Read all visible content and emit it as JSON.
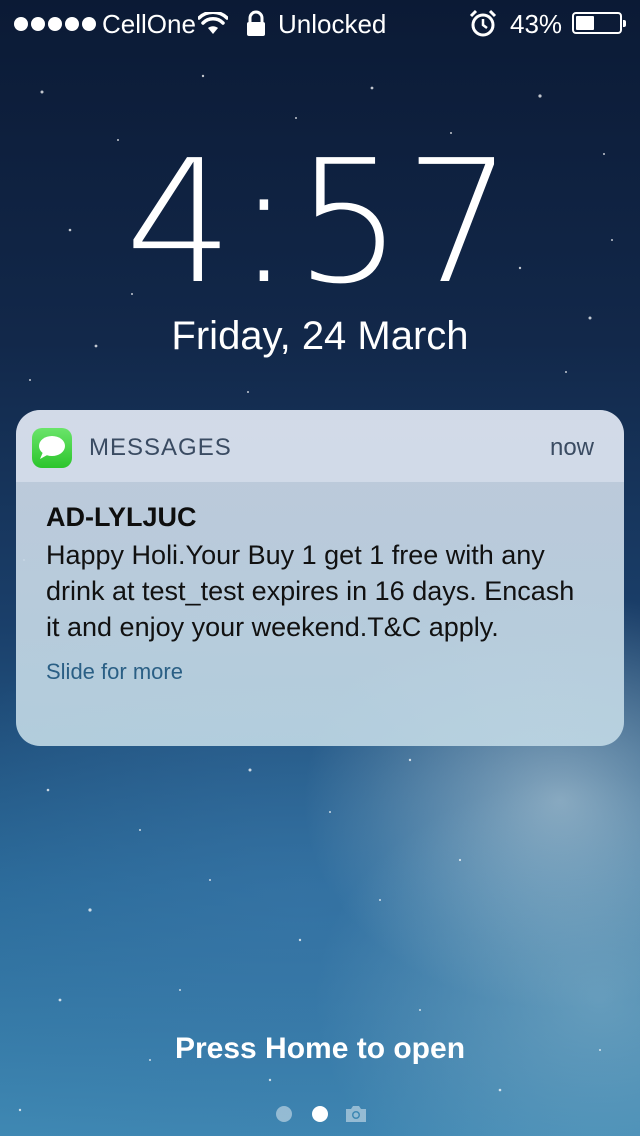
{
  "status_bar": {
    "signal_dots": 5,
    "carrier": "CellOne",
    "wifi_icon": "wifi-icon",
    "lock_icon": "lock-icon",
    "lock_label": "Unlocked",
    "alarm_icon": "alarm-clock-icon",
    "battery_percent": "43%",
    "battery_level": 0.43
  },
  "lock_screen": {
    "time": "4:57",
    "date": "Friday, 24 March"
  },
  "notification": {
    "app_icon": "messages-icon",
    "app_name": "MESSAGES",
    "timestamp": "now",
    "sender": "AD-LYLJUC",
    "message": "Happy Holi.Your Buy 1 get 1 free with any drink at test_test expires in 16 days. Encash it and enjoy your weekend.T&C apply.",
    "action_hint": "Slide for more"
  },
  "footer": {
    "press_home": "Press Home to open",
    "page_indicator": {
      "pages": 2,
      "current": 2,
      "camera_icon": "camera-icon"
    }
  },
  "colors": {
    "notification_bg": "#cdd7e6",
    "app_name_color": "#3a4b62",
    "action_hint_color": "#2a5f85",
    "messages_green": "#2cc52c"
  }
}
